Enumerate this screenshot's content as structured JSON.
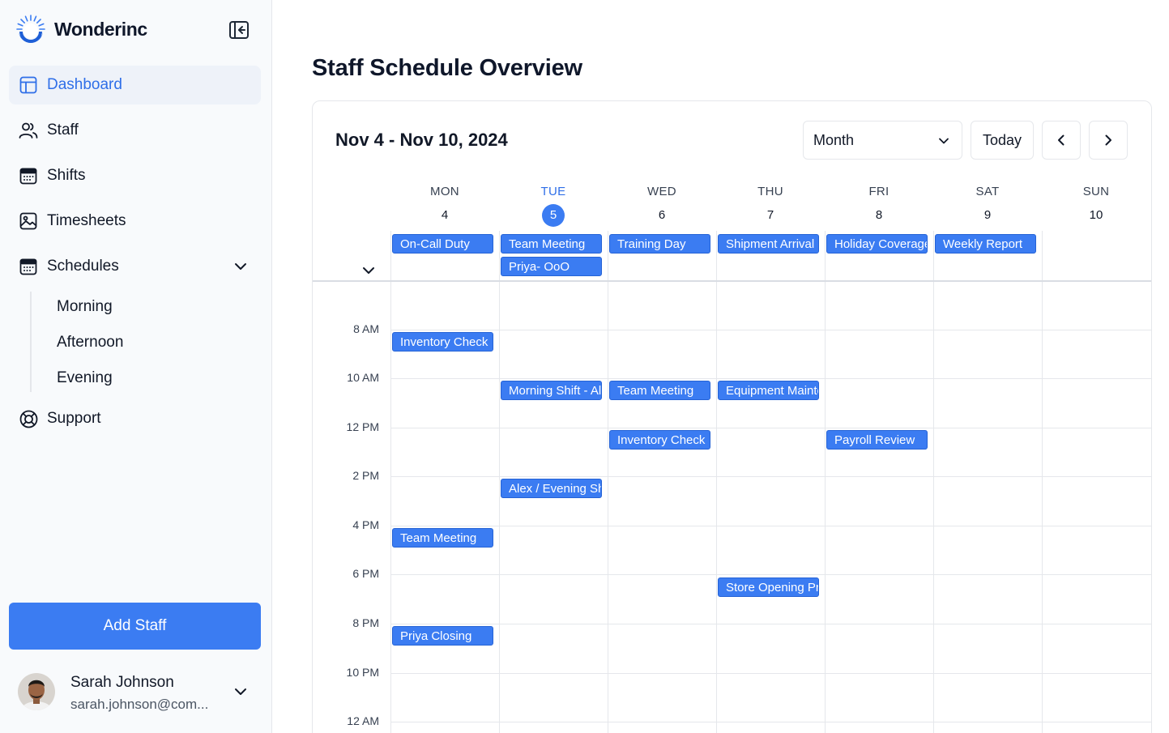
{
  "brand": {
    "name": "Wonderinc"
  },
  "sidebar": {
    "items": [
      {
        "label": "Dashboard"
      },
      {
        "label": "Staff"
      },
      {
        "label": "Shifts"
      },
      {
        "label": "Timesheets"
      },
      {
        "label": "Schedules"
      },
      {
        "label": "Support"
      }
    ],
    "schedules_sub": [
      {
        "label": "Morning"
      },
      {
        "label": "Afternoon"
      },
      {
        "label": "Evening"
      }
    ],
    "add_staff_label": "Add Staff"
  },
  "user": {
    "name": "Sarah Johnson",
    "email": "sarah.johnson@com..."
  },
  "main": {
    "page_title": "Staff Schedule Overview",
    "calendar": {
      "range_title": "Nov 4 - Nov 10, 2024",
      "view_select": "Month",
      "today_label": "Today",
      "days": [
        {
          "name": "MON",
          "num": "4"
        },
        {
          "name": "TUE",
          "num": "5"
        },
        {
          "name": "WED",
          "num": "6"
        },
        {
          "name": "THU",
          "num": "7"
        },
        {
          "name": "FRI",
          "num": "8"
        },
        {
          "name": "SAT",
          "num": "9"
        },
        {
          "name": "SUN",
          "num": "10"
        }
      ],
      "today_index": 1,
      "time_labels": [
        "8 AM",
        "10 AM",
        "12 PM",
        "2 PM",
        "4 PM",
        "6 PM",
        "8 PM",
        "10 PM",
        "12 AM"
      ],
      "all_day_events": [
        {
          "title": "On-Call Duty",
          "day": 0,
          "row": 0
        },
        {
          "title": "Team Meeting",
          "day": 1,
          "row": 0
        },
        {
          "title": "Priya- OoO",
          "day": 1,
          "row": 1
        },
        {
          "title": "Training Day",
          "day": 2,
          "row": 0
        },
        {
          "title": "Shipment Arrival",
          "day": 3,
          "row": 0
        },
        {
          "title": "Holiday Coverage",
          "day": 4,
          "row": 0
        },
        {
          "title": "Weekly Report",
          "day": 5,
          "row": 0
        }
      ],
      "timed_events": [
        {
          "title": "Inventory Check",
          "day": 0,
          "slot": 1
        },
        {
          "title": "Morning Shift - Alex",
          "day": 1,
          "slot": 2
        },
        {
          "title": "Team Meeting",
          "day": 2,
          "slot": 2
        },
        {
          "title": "Equipment Maintenance",
          "day": 3,
          "slot": 2
        },
        {
          "title": "Inventory Check",
          "day": 2,
          "slot": 3
        },
        {
          "title": "Payroll Review",
          "day": 4,
          "slot": 3
        },
        {
          "title": "Alex / Evening Shift",
          "day": 1,
          "slot": 4
        },
        {
          "title": "Team Meeting",
          "day": 0,
          "slot": 5
        },
        {
          "title": "Store Opening Prep",
          "day": 3,
          "slot": 6
        },
        {
          "title": "Priya Closing",
          "day": 0,
          "slot": 7
        }
      ]
    }
  },
  "colors": {
    "accent": "#3b7cf2",
    "active_nav_bg": "#eef2f9",
    "active_nav_text": "#2f6fe8"
  },
  "icons": {
    "collapse": "sidebar-collapse-icon",
    "dashboard": "layout-icon",
    "staff": "users-icon",
    "shifts": "calendar-icon",
    "timesheets": "image-icon",
    "schedules": "calendar-icon",
    "support": "lifebuoy-icon"
  }
}
